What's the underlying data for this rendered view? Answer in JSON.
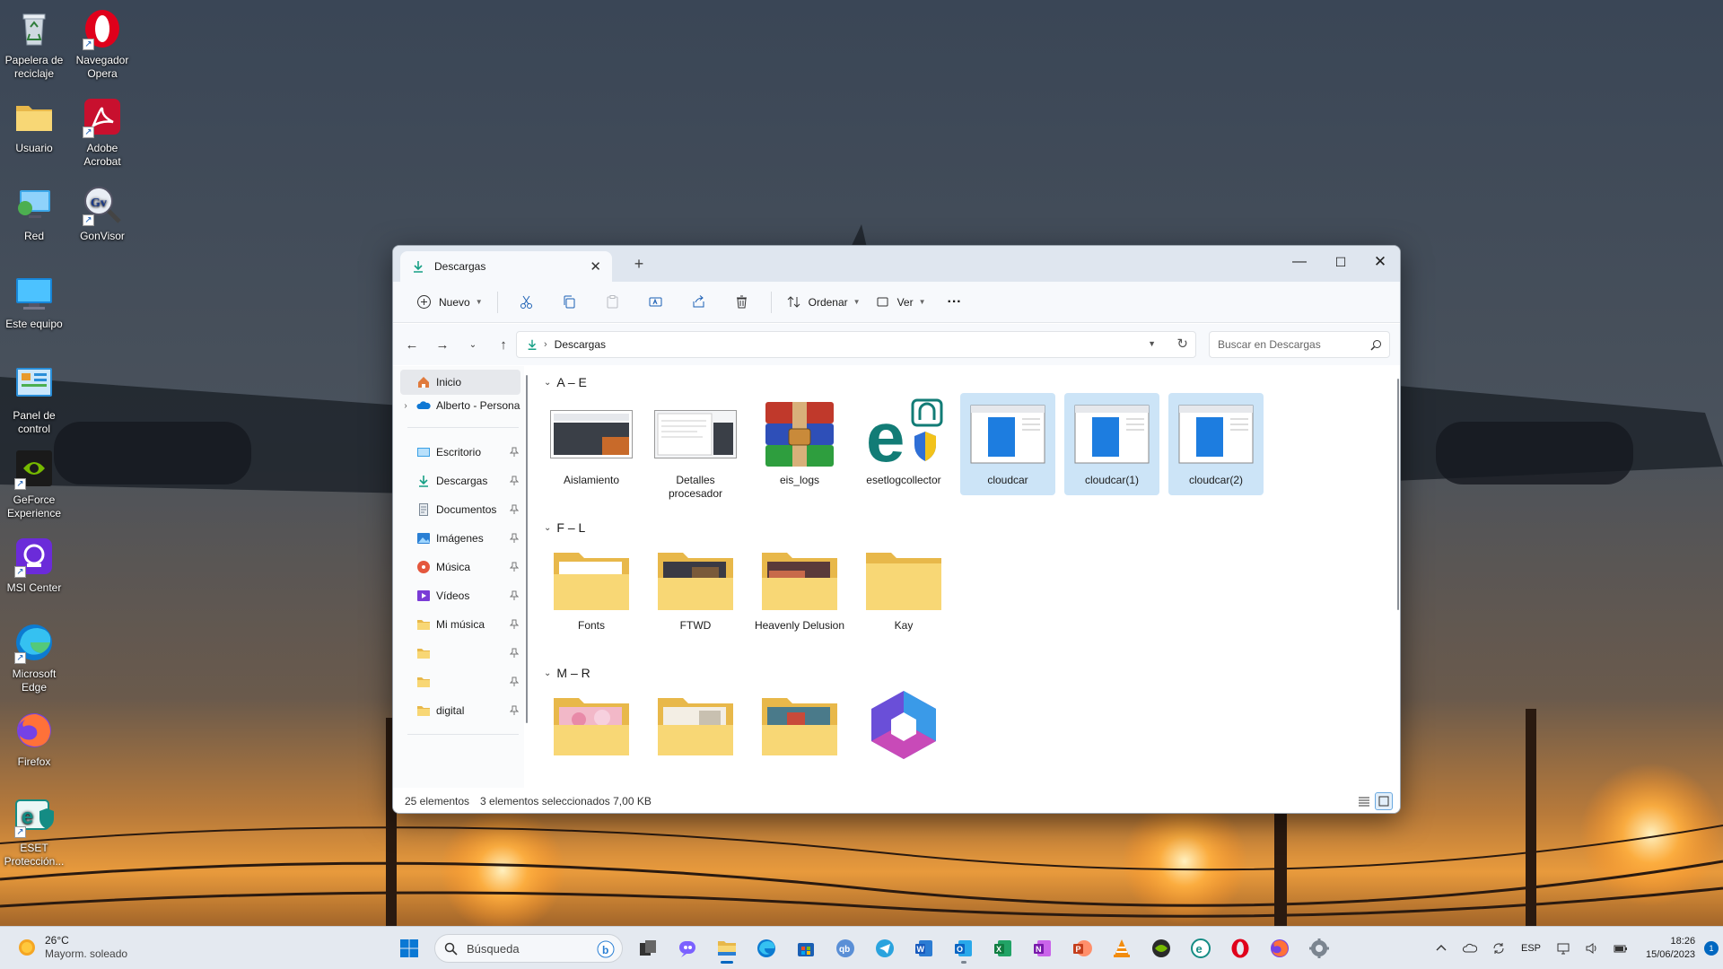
{
  "desktop": {
    "icons": [
      {
        "label": "Papelera de reciclaje",
        "icon": "recycle-bin-icon"
      },
      {
        "label": "Navegador Opera",
        "icon": "opera-icon"
      },
      {
        "label": "Usuario",
        "icon": "folder-icon"
      },
      {
        "label": "Adobe Acrobat",
        "icon": "acrobat-icon"
      },
      {
        "label": "Red",
        "icon": "network-icon"
      },
      {
        "label": "GonVisor",
        "icon": "gonvisor-icon"
      },
      {
        "label": "Este equipo",
        "icon": "computer-icon"
      },
      {
        "label": "Panel de control",
        "icon": "control-panel-icon"
      },
      {
        "label": "GeForce Experience",
        "icon": "geforce-icon"
      },
      {
        "label": "MSI Center",
        "icon": "msi-center-icon"
      },
      {
        "label": "Microsoft Edge",
        "icon": "edge-icon"
      },
      {
        "label": "Firefox",
        "icon": "firefox-icon"
      },
      {
        "label": "ESET Protección...",
        "icon": "eset-icon"
      }
    ]
  },
  "explorer": {
    "tab_title": "Descargas",
    "new_tab": "+",
    "window_controls": {
      "minimize": "—",
      "maximize": "☐",
      "close": "✕"
    },
    "toolbar": {
      "new_label": "Nuevo",
      "sort_label": "Ordenar",
      "view_label": "Ver",
      "more_label": "···"
    },
    "address": {
      "current": "Descargas",
      "separator": "›"
    },
    "search": {
      "placeholder": "Buscar en Descargas"
    },
    "nav": {
      "home": "Inicio",
      "onedrive": "Alberto - Personal",
      "quick_access": [
        {
          "label": "Escritorio",
          "icon": "desktop-folder-icon"
        },
        {
          "label": "Descargas",
          "icon": "downloads-icon"
        },
        {
          "label": "Documentos",
          "icon": "documents-icon"
        },
        {
          "label": "Imágenes",
          "icon": "pictures-icon"
        },
        {
          "label": "Música",
          "icon": "music-icon"
        },
        {
          "label": "Vídeos",
          "icon": "videos-icon"
        },
        {
          "label": "Mi música",
          "icon": "folder-icon"
        },
        {
          "label": "",
          "icon": "folder-icon"
        },
        {
          "label": "",
          "icon": "folder-icon"
        },
        {
          "label": "digital",
          "icon": "folder-icon"
        }
      ]
    },
    "groups": [
      {
        "header": "A – E",
        "items": [
          {
            "name": "Aislamiento",
            "kind": "screenshot",
            "selected": false
          },
          {
            "name": "Detalles procesador",
            "kind": "screenshot",
            "selected": false
          },
          {
            "name": "eis_logs",
            "kind": "winrar",
            "selected": false
          },
          {
            "name": "esetlogcollector",
            "kind": "eset",
            "selected": false
          },
          {
            "name": "cloudcar",
            "kind": "window",
            "selected": true
          },
          {
            "name": "cloudcar(1)",
            "kind": "window",
            "selected": true
          },
          {
            "name": "cloudcar(2)",
            "kind": "window",
            "selected": true
          }
        ]
      },
      {
        "header": "F – L",
        "items": [
          {
            "name": "Fonts",
            "kind": "folder-doc",
            "selected": false
          },
          {
            "name": "FTWD",
            "kind": "folder-photo",
            "selected": false
          },
          {
            "name": "Heavenly Delusion",
            "kind": "folder-photo2",
            "selected": false
          },
          {
            "name": "Kay",
            "kind": "folder",
            "selected": false
          }
        ]
      },
      {
        "header": "M – R",
        "items": [
          {
            "name": "",
            "kind": "folder-pink",
            "selected": false
          },
          {
            "name": "",
            "kind": "folder-light",
            "selected": false
          },
          {
            "name": "",
            "kind": "folder-photo",
            "selected": false
          },
          {
            "name": "",
            "kind": "m365",
            "selected": false
          }
        ]
      }
    ],
    "status": {
      "count": "25 elementos",
      "selection": "3 elementos seleccionados  7,00 KB"
    }
  },
  "taskbar": {
    "weather": {
      "temp": "26°C",
      "desc": "Mayorm. soleado"
    },
    "search_label": "Búsqueda",
    "apps": [
      "start-icon",
      "search",
      "task-view-icon",
      "teams-icon",
      "file-explorer-icon",
      "edge-icon",
      "store-icon",
      "qbittorrent-icon",
      "telegram-icon",
      "word-icon",
      "outlook-icon",
      "excel-icon",
      "onenote-icon",
      "powerpoint-icon",
      "vlc-icon",
      "geforce-icon",
      "eset-icon",
      "opera-icon",
      "firefox-icon",
      "settings-icon"
    ],
    "tray": {
      "language": "ESP",
      "time": "18:26",
      "date": "15/06/2023",
      "notifications": "1"
    }
  },
  "colors": {
    "accent": "#0067c0",
    "selection": "#cce4f7",
    "folder": "#f8d775",
    "taskbar": "#e4e9f0"
  }
}
